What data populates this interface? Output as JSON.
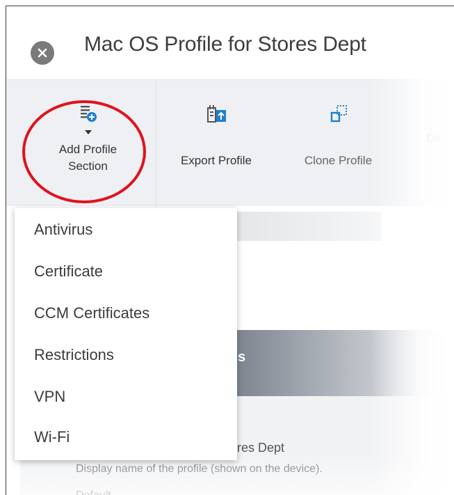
{
  "header": {
    "title": "Mac OS Profile for Stores Dept",
    "close_icon": "close-icon"
  },
  "toolbar": {
    "add_profile_section": {
      "line1": "Add Profile",
      "line2": "Section",
      "icon": "add-list-icon"
    },
    "export_profile": {
      "label": "Export Profile",
      "icon": "export-icon"
    },
    "clone_profile": {
      "label": "Clone Profile",
      "icon": "clone-icon"
    },
    "truncated": {
      "label": "De"
    }
  },
  "dropdown": {
    "items": [
      "Antivirus",
      "Certificate",
      "CCM Certificates",
      "Restrictions",
      "VPN",
      "Wi-Fi"
    ]
  },
  "background": {
    "section_header_fragment": "s",
    "name_value_fragment": "ores Dept",
    "name_help": "Display name of the profile (shown on the device).",
    "next_field_fragment": "Default"
  },
  "colors": {
    "highlight_circle": "#e0121b",
    "accent_blue": "#1e7fd0",
    "toolbar_bg": "#eef0f3"
  }
}
